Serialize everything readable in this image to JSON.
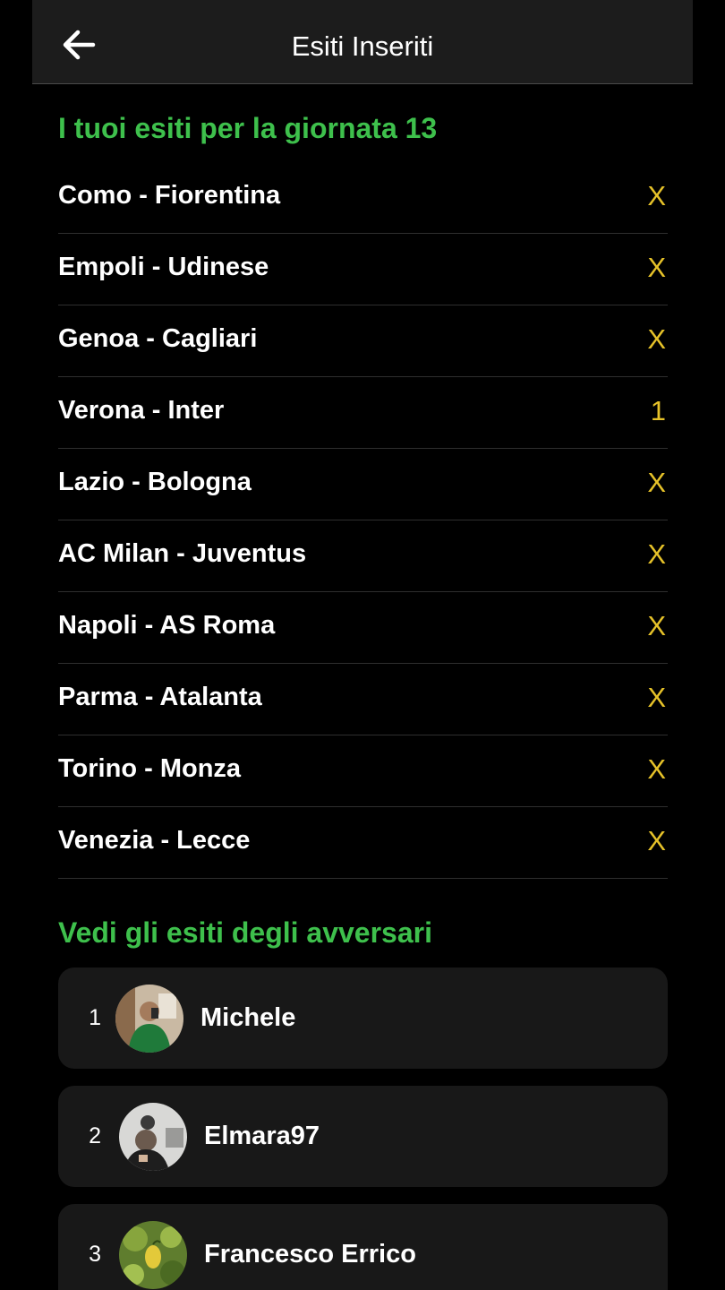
{
  "header": {
    "title": "Esiti Inseriti",
    "back_icon": "arrow-left-icon"
  },
  "my_results": {
    "title": "I tuoi esiti per la giornata 13",
    "matches": [
      {
        "name": "Como - Fiorentina",
        "result": "X"
      },
      {
        "name": "Empoli - Udinese",
        "result": "X"
      },
      {
        "name": "Genoa - Cagliari",
        "result": "X"
      },
      {
        "name": "Verona - Inter",
        "result": "1"
      },
      {
        "name": "Lazio - Bologna",
        "result": "X"
      },
      {
        "name": "AC Milan - Juventus",
        "result": "X"
      },
      {
        "name": "Napoli - AS Roma",
        "result": "X"
      },
      {
        "name": "Parma - Atalanta",
        "result": "X"
      },
      {
        "name": "Torino - Monza",
        "result": "X"
      },
      {
        "name": "Venezia - Lecce",
        "result": "X"
      }
    ]
  },
  "opponents": {
    "title": "Vedi gli esiti degli avversari",
    "items": [
      {
        "rank": "1",
        "name": "Michele"
      },
      {
        "rank": "2",
        "name": "Elmara97"
      },
      {
        "rank": "3",
        "name": "Francesco Errico"
      }
    ]
  },
  "colors": {
    "accent_green": "#3ec04c",
    "result_yellow": "#e6c229",
    "header_bg": "#1c1c1c",
    "card_bg": "#181818"
  }
}
